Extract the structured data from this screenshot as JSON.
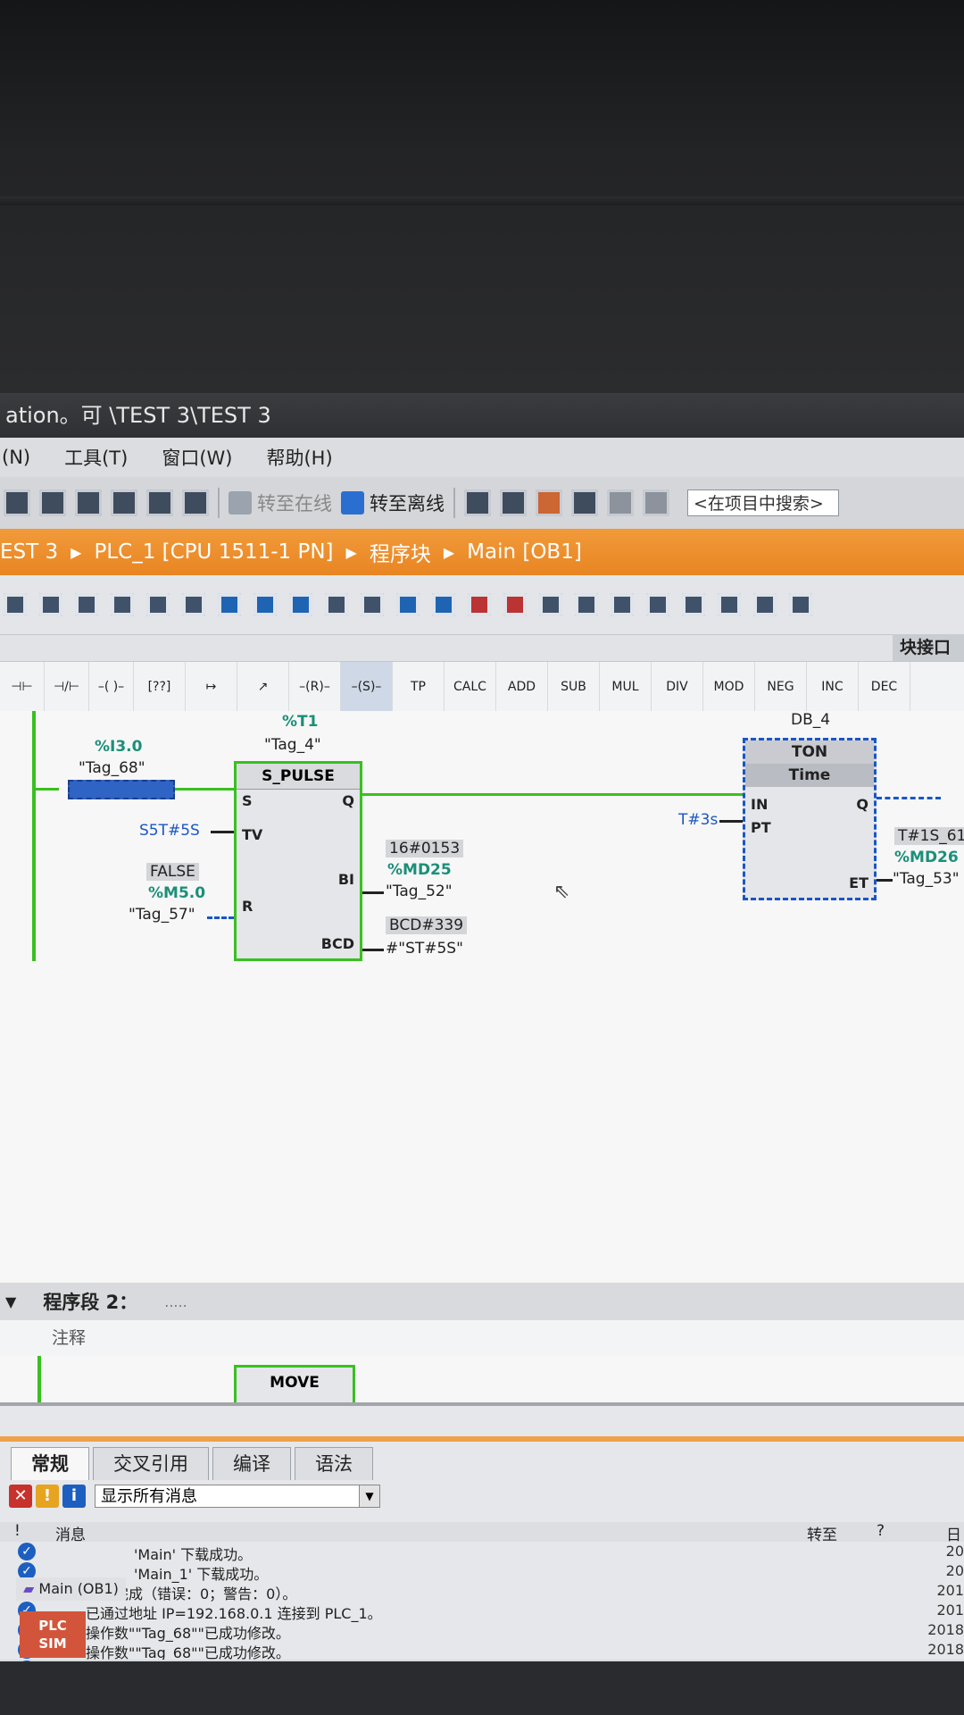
{
  "window": {
    "title": "ation。可 \\TEST 3\\TEST 3"
  },
  "menu": [
    "(N)",
    "工具(T)",
    "窗口(W)",
    "帮助(H)"
  ],
  "toolbar": {
    "go_online": "转至在线",
    "go_offline": "转至离线",
    "search_placeholder": "<在项目中搜索>"
  },
  "breadcrumb": [
    "EST 3",
    "PLC_1 [CPU 1511-1 PN]",
    "程序块",
    "Main [OB1]"
  ],
  "panel": {
    "right_tab": "块接口"
  },
  "instructions": [
    "TP",
    "CALC",
    "ADD",
    "SUB",
    "MUL",
    "DIV",
    "MOD",
    "NEG",
    "INC",
    "DEC"
  ],
  "network1": {
    "contact": {
      "addr": "%I3.0",
      "tag": "\"Tag_68\""
    },
    "spulse": {
      "instance_addr": "%T1",
      "instance_tag": "\"Tag_4\"",
      "name": "S_PULSE",
      "pins": {
        "s": "S",
        "tv": "TV",
        "r": "R",
        "q": "Q",
        "bi": "BI",
        "bcd": "BCD"
      },
      "tv_value": "S5T#5S",
      "r_value": "FALSE",
      "r_addr": "%M5.0",
      "r_tag": "\"Tag_57\"",
      "bi_value": "16#0153",
      "bi_addr": "%MD25",
      "bi_tag": "\"Tag_52\"",
      "bcd_value": "BCD#339",
      "bcd_tag": "#\"ST#5S\""
    },
    "ton": {
      "instance": "DB_4",
      "name": "TON",
      "type": "Time",
      "pins": {
        "in": "IN",
        "pt": "PT",
        "q": "Q",
        "et": "ET"
      },
      "pt_value": "T#3s",
      "et_value": "T#1S_61",
      "et_addr": "%MD26",
      "et_tag": "\"Tag_53\""
    }
  },
  "network2": {
    "title": "程序段 2：",
    "dots": ".....",
    "comment": "注释",
    "block": "MOVE"
  },
  "inspector": {
    "tabs": [
      "常规",
      "交叉引用",
      "编译",
      "语法"
    ],
    "filter": "显示所有消息",
    "columns": {
      "msg": "消息",
      "goto": "转至",
      "q": "?",
      "date": "日"
    },
    "messages": [
      {
        "text": "'Main' 下载成功。",
        "indent": 150,
        "icon": "check",
        "date": "20"
      },
      {
        "text": "'Main_1' 下载成功。",
        "indent": 150,
        "icon": "check",
        "date": "20"
      },
      {
        "text": "下载完成（错误：0；警告：0）。",
        "indent": 96,
        "icon": "check",
        "date": "201"
      },
      {
        "text": "已通过地址 IP=192.168.0.1 连接到 PLC_1。",
        "indent": 96,
        "icon": "check",
        "date": "201"
      },
      {
        "text": "操作数\"\"Tag_68\"\"已成功修改。",
        "indent": 96,
        "icon": "info",
        "date": "2018"
      },
      {
        "text": "操作数\"\"Tag_68\"\"已成功修改。",
        "indent": 96,
        "icon": "info",
        "date": "2018"
      },
      {
        "text": "操作数\"\"Tag_68\"\"已成功修改。",
        "indent": 96,
        "icon": "info",
        "date": "2018"
      }
    ]
  },
  "taskbar": {
    "main": "Main (OB1)",
    "plcsim_line1": "PLC",
    "plcsim_line2": "SIM"
  }
}
